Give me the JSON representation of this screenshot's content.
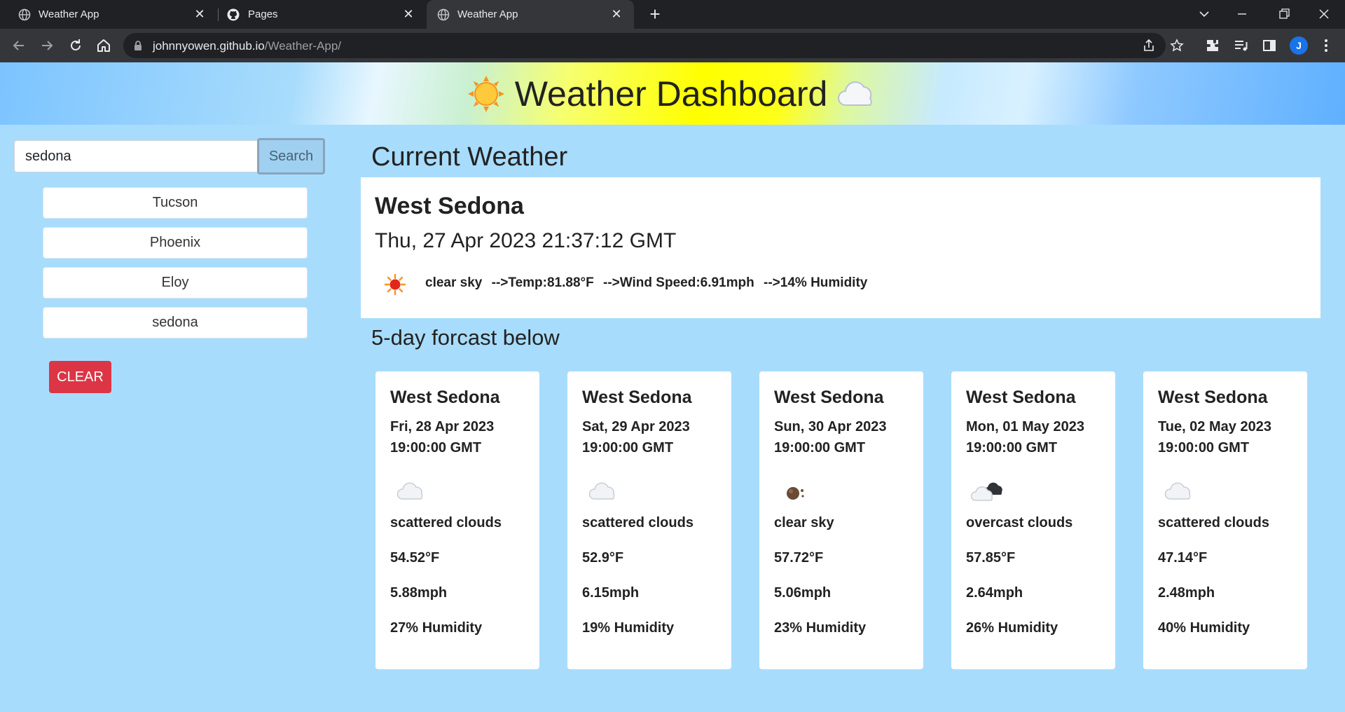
{
  "browser": {
    "tabs": [
      {
        "title": "Weather App",
        "icon": "globe-icon",
        "active": false
      },
      {
        "title": "Pages",
        "icon": "github-icon",
        "active": false
      },
      {
        "title": "Weather App",
        "icon": "globe-icon",
        "active": true
      }
    ],
    "url_host": "johnnyowen.github.io",
    "url_path": "/Weather-App/",
    "profile_initial": "J"
  },
  "header": {
    "title": "Weather Dashboard",
    "left_glyph": "sun-icon",
    "right_glyph": "cloud-icon"
  },
  "search": {
    "value": "sedona",
    "button_label": "Search"
  },
  "history": [
    "Tucson",
    "Phoenix",
    "Eloy",
    "sedona"
  ],
  "clear_label": "CLEAR",
  "current": {
    "section_title": "Current Weather",
    "city": "West Sedona",
    "datetime": "Thu, 27 Apr 2023 21:37:12 GMT",
    "icon": "sun-icon",
    "description": "clear sky",
    "temp_text": "-->Temp:81.88°F",
    "wind_text": "-->Wind Speed:6.91mph",
    "humidity_text": "-->14% Humidity"
  },
  "forecast": {
    "section_title": "5-day forcast below",
    "days": [
      {
        "city": "West Sedona",
        "date": "Fri, 28 Apr 2023",
        "time": "19:00:00 GMT",
        "icon": "scattered-clouds-icon",
        "description": "scattered clouds",
        "temp": "54.52°F",
        "wind": "5.88mph",
        "humidity": "27% Humidity"
      },
      {
        "city": "West Sedona",
        "date": "Sat, 29 Apr 2023",
        "time": "19:00:00 GMT",
        "icon": "scattered-clouds-icon",
        "description": "scattered clouds",
        "temp": "52.9°F",
        "wind": "6.15mph",
        "humidity": "19% Humidity"
      },
      {
        "city": "West Sedona",
        "date": "Sun, 30 Apr 2023",
        "time": "19:00:00 GMT",
        "icon": "clear-night-icon",
        "description": "clear sky",
        "temp": "57.72°F",
        "wind": "5.06mph",
        "humidity": "23% Humidity"
      },
      {
        "city": "West Sedona",
        "date": "Mon, 01 May 2023",
        "time": "19:00:00 GMT",
        "icon": "overcast-clouds-icon",
        "description": "overcast clouds",
        "temp": "57.85°F",
        "wind": "2.64mph",
        "humidity": "26% Humidity"
      },
      {
        "city": "West Sedona",
        "date": "Tue, 02 May 2023",
        "time": "19:00:00 GMT",
        "icon": "scattered-clouds-icon",
        "description": "scattered clouds",
        "temp": "47.14°F",
        "wind": "2.48mph",
        "humidity": "40% Humidity"
      }
    ]
  },
  "colors": {
    "page_bg": "#a8dcfc",
    "clear_button": "#dc3545",
    "chrome_dark": "#202124",
    "chrome_toolbar": "#35363a"
  }
}
